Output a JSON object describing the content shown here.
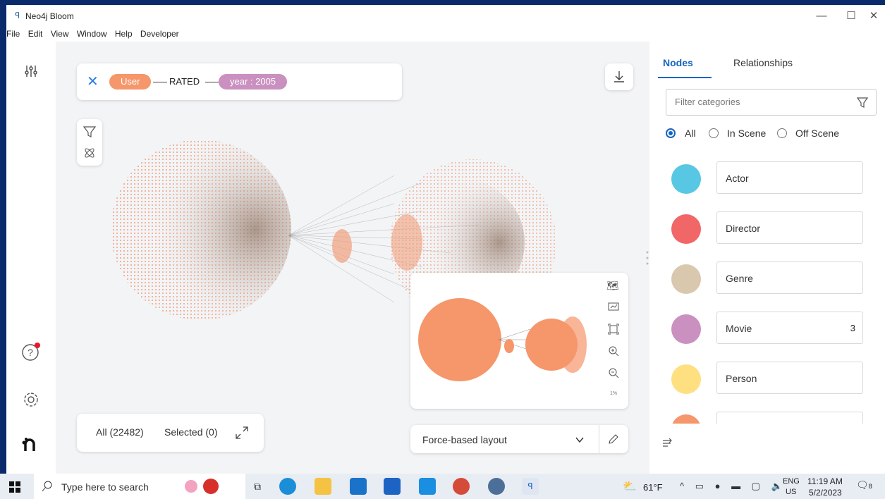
{
  "window": {
    "title": "Neo4j Bloom",
    "controls": {
      "minimize": "—",
      "maximize": "☐",
      "close": "✕"
    }
  },
  "menu": [
    "File",
    "Edit",
    "View",
    "Window",
    "Help",
    "Developer"
  ],
  "search": {
    "pill_user": "User",
    "rel_label": "RATED",
    "pill_year": "year : 2005",
    "colors": {
      "user": "#f5966b",
      "year": "#c990c0"
    }
  },
  "status": {
    "all": "All (22482)",
    "selected": "Selected (0)"
  },
  "layout": {
    "selected": "Force-based layout"
  },
  "minimap": {
    "zoom": "1%"
  },
  "panel": {
    "tabs": [
      "Nodes",
      "Relationships"
    ],
    "active_tab": "Nodes",
    "filter_placeholder": "Filter categories",
    "radio": [
      "All",
      "In Scene",
      "Off Scene"
    ],
    "radio_selected": "All",
    "categories": [
      {
        "label": "Actor",
        "color": "#57c7e3",
        "count": ""
      },
      {
        "label": "Director",
        "color": "#f16667",
        "count": ""
      },
      {
        "label": "Genre",
        "color": "#d9c8ae",
        "count": ""
      },
      {
        "label": "Movie",
        "color": "#c990c0",
        "count": "3"
      },
      {
        "label": "Person",
        "color": "#ffe081",
        "count": ""
      }
    ]
  },
  "taskbar": {
    "search_placeholder": "Type here to search",
    "weather": "61°F",
    "lang_top": "ENG",
    "lang_bottom": "US",
    "time": "11:19 AM",
    "date": "5/2/2023",
    "notif_count": "8"
  }
}
